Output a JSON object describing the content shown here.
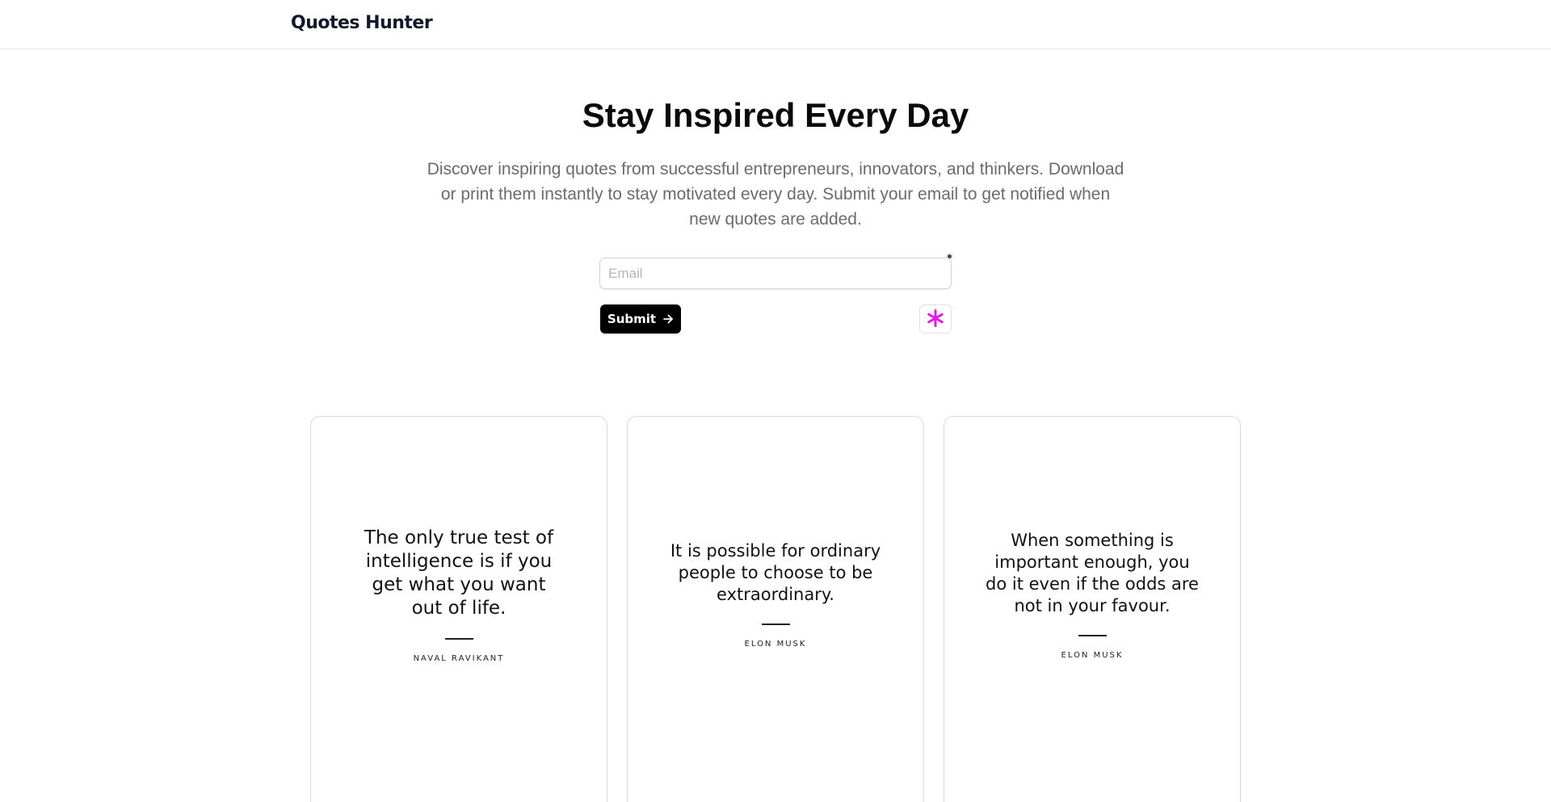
{
  "header": {
    "brand": "Quotes Hunter"
  },
  "hero": {
    "title": "Stay Inspired Every Day",
    "subtitle": "Discover inspiring quotes from successful entrepreneurs, innovators, and thinkers. Download or print them instantly to stay motivated every day. Submit your email to get notified when new quotes are added."
  },
  "form": {
    "email_placeholder": "Email",
    "email_value": "",
    "submit_label": "Submit",
    "submit_icon": "arrow-right-icon",
    "extra_button_icon": "asterisk-icon"
  },
  "quotes": [
    {
      "text": "The only true test of intelligence is if you get what you want out of life.",
      "author": "NAVAL RAVIKANT"
    },
    {
      "text": "It is possible for ordinary people to choose to be extraordinary.",
      "author": "ELON MUSK"
    },
    {
      "text": "When something is important enough, you do it even if the odds are not in your favour.",
      "author": "ELON MUSK"
    }
  ],
  "colors": {
    "accent_asterisk": "#e21ae8",
    "button_bg": "#000000",
    "subtitle_text": "#6b6b6b"
  }
}
